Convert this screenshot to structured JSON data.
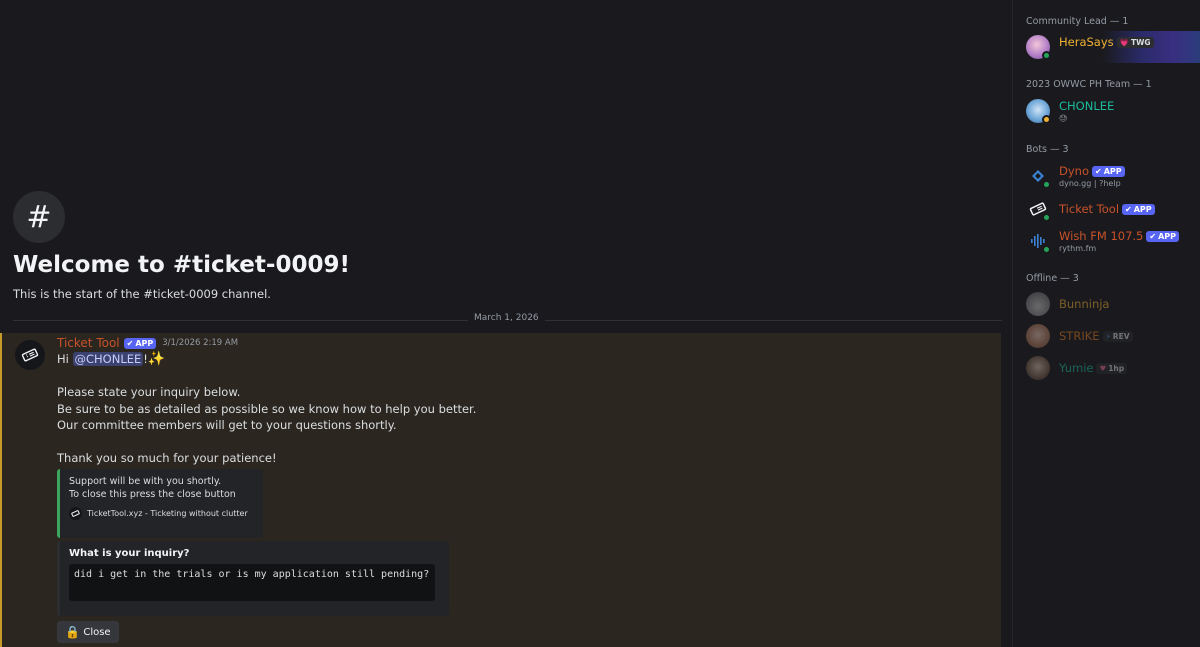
{
  "channel": {
    "hash_symbol": "#",
    "welcome_title": "Welcome to #ticket-0009!",
    "welcome_sub": "This is the start of the #ticket-0009 channel.",
    "date_divider": "March 1, 2026"
  },
  "message": {
    "author": "Ticket Tool",
    "badge": "APP",
    "timestamp": "3/1/2026 2:19 AM",
    "greeting_prefix": "Hi ",
    "mention": "@CHONLEE",
    "greeting_suffix": "!",
    "sparkle": "✨",
    "line1": "Please state your inquiry below.",
    "line2": "Be sure to be as detailed as possible so we know how to help you better.",
    "line3": "Our committee members will get to your questions shortly.",
    "line4": "Thank you so much for your patience!",
    "embed1": {
      "line1": "Support will be with you shortly.",
      "line2": "To close this press the close button",
      "footer": "TicketTool.xyz - Ticketing without clutter"
    },
    "embed2": {
      "question": "What is your inquiry?",
      "answer": "did i get in the trials or is my application still pending?"
    },
    "close_button": {
      "icon": "🔒",
      "label": "Close"
    }
  },
  "members": {
    "groups": [
      {
        "title": "Community Lead — 1"
      },
      {
        "title": "2023 OWWC PH Team — 1"
      },
      {
        "title": "Bots — 3"
      },
      {
        "title": "Offline — 3"
      }
    ],
    "hera": {
      "name": "HeraSays",
      "tag": "TWG",
      "tag_icon": "💗",
      "color": "#f0b232"
    },
    "chonlee": {
      "name": "CHONLEE",
      "sub": "😓",
      "color": "#1abc9c"
    },
    "dyno": {
      "name": "Dyno",
      "badge": "APP",
      "sub": "dyno.gg | ?help",
      "color": "#c8522a"
    },
    "tickettool": {
      "name": "Ticket Tool",
      "badge": "APP",
      "color": "#c8522a"
    },
    "wishfm": {
      "name": "Wish FM 107.5",
      "badge": "APP",
      "sub": "rythm.fm",
      "color": "#c8522a"
    },
    "bunninja": {
      "name": "Bunninja",
      "color": "#f0b232"
    },
    "strike": {
      "name": "STRIKE",
      "tag": "REV",
      "tag_icon": "⚡",
      "color": "#e67e22"
    },
    "yumie": {
      "name": "Yumie",
      "tag": "1hp",
      "tag_icon": "♥",
      "color": "#1abc9c"
    }
  }
}
